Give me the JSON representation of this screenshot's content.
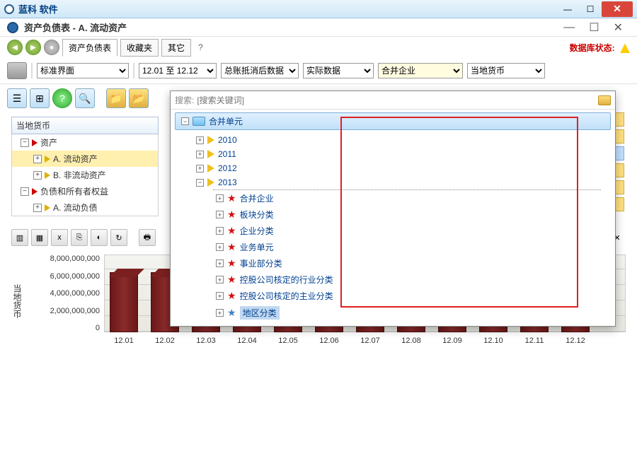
{
  "app": {
    "name": "蓝科 软件"
  },
  "window": {
    "title": "资产负债表 - A. 流动资产",
    "tabs": [
      "资产负债表",
      "收藏夹",
      "其它"
    ],
    "db_status_label": "数据库状态:"
  },
  "dropdowns": {
    "scope": "标准界面",
    "period": "12.01 至 12.12",
    "ledger": "总账抵消后数据",
    "data_kind": "实际数据",
    "entity": "合并企业",
    "currency": "当地货币"
  },
  "left_panel": {
    "header": "当地货币",
    "nodes": [
      {
        "level": 0,
        "expanded": true,
        "icon": "tri-red",
        "label": "资产"
      },
      {
        "level": 1,
        "expanded": false,
        "icon": "tri-yellow",
        "label": "A. 流动资产",
        "selected": true
      },
      {
        "level": 1,
        "expanded": false,
        "icon": "tri-yellow",
        "label": "B. 非流动资产"
      },
      {
        "level": 0,
        "expanded": true,
        "icon": "tri-red",
        "label": "负债和所有者权益"
      },
      {
        "level": 1,
        "expanded": false,
        "icon": "tri-yellow",
        "label": "A. 流动负债"
      }
    ]
  },
  "search_overlay": {
    "search_label": "搜索:",
    "placeholder": "[搜索关键词]",
    "root": "合并单元",
    "years": [
      {
        "label": "2010",
        "expanded": false
      },
      {
        "label": "2011",
        "expanded": false
      },
      {
        "label": "2012",
        "expanded": false
      },
      {
        "label": "2013",
        "expanded": true
      }
    ],
    "children_2013": [
      {
        "icon": "star",
        "label": "合并企业"
      },
      {
        "icon": "star",
        "label": "板块分类"
      },
      {
        "icon": "star",
        "label": "企业分类"
      },
      {
        "icon": "star",
        "label": "业务单元"
      },
      {
        "icon": "star",
        "label": "事业部分类"
      },
      {
        "icon": "star",
        "label": "控股公司核定的行业分类"
      },
      {
        "icon": "star",
        "label": "控股公司核定的主业分类"
      },
      {
        "icon": "star-blue",
        "label": "地区分类",
        "selected": true
      }
    ]
  },
  "chart_data": {
    "type": "bar",
    "ylabel": "当地货币",
    "categories": [
      "12.01",
      "12.02",
      "12.03",
      "12.04",
      "12.05",
      "12.06",
      "12.07",
      "12.08",
      "12.09",
      "12.10",
      "12.11",
      "12.12"
    ],
    "values": [
      6200000000,
      6200000000,
      6100000000,
      6200000000,
      6100000000,
      6000000000,
      6100000000,
      6200000000,
      6300000000,
      6200000000,
      6300000000,
      6500000000
    ],
    "ylim": [
      0,
      8000000000
    ],
    "y_ticks": [
      "8,000,000,000",
      "6,000,000,000",
      "4,000,000,000",
      "2,000,000,000",
      "0"
    ]
  }
}
